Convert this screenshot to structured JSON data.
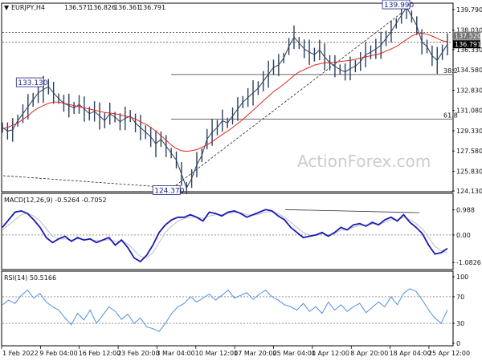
{
  "header": {
    "arrow": "▼",
    "symbol": "EURJPY,H4",
    "open": "136.571",
    "high": "136.826",
    "low": "136.361",
    "close": "136.791"
  },
  "watermark": "ActionForex.com",
  "colors": {
    "price": "#2b3f5c",
    "ma": "#e0251b",
    "macd": "#1a1ab0",
    "signal": "#b8bec9",
    "rsi": "#4f8fe0",
    "tag_dark": "#000000",
    "tag_gray": "#777777"
  },
  "x_axis_labels": [
    "1 Feb 2022",
    "9 Feb 04:00",
    "16 Feb 12:00",
    "23 Feb 20:00",
    "3 Mar 04:00",
    "10 Mar 12:00",
    "17 Mar 20:00",
    "25 Mar 04:00",
    "1 Apr 12:00",
    "8 Apr 20:00",
    "18 Apr 04:00",
    "25 Apr 12:00"
  ],
  "chart_data": [
    {
      "type": "line",
      "panel": "price",
      "y_ticks": [
        "139.790",
        "138.030",
        "137.520",
        "136.791",
        "136.330",
        "134.580",
        "132.830",
        "131.080",
        "129.330",
        "127.580",
        "125.830",
        "124.130"
      ],
      "ylim": [
        124.13,
        140.2
      ],
      "current_tags": [
        "137.520",
        "136.791"
      ],
      "annotations": [
        "133.130",
        "124.370",
        "139.990"
      ],
      "fib_levels": [
        {
          "label": "38.2",
          "value": 134.18
        },
        {
          "label": "61.8",
          "value": 130.32
        }
      ],
      "dotted_levels": [
        137.82,
        136.96
      ],
      "series": [
        {
          "values": [
            129.6,
            129.3,
            129.4,
            130.2,
            130.8,
            131.4,
            132.0,
            132.6,
            132.9,
            133.13,
            132.6,
            132.1,
            131.7,
            131.5,
            131.3,
            131.6,
            131.2,
            130.8,
            131.0,
            130.6,
            130.2,
            130.8,
            130.5,
            130.1,
            130.4,
            130.6,
            130.0,
            129.6,
            129.2,
            128.8,
            128.2,
            128.6,
            128.0,
            127.4,
            126.8,
            125.6,
            124.37,
            125.2,
            126.4,
            127.2,
            128.6,
            129.2,
            129.6,
            130.2,
            130.0,
            130.6,
            131.2,
            131.8,
            132.2,
            132.6,
            133.0,
            133.6,
            134.2,
            134.8,
            135.0,
            135.6,
            136.6,
            137.4,
            136.9,
            136.4,
            136.1,
            135.9,
            136.3,
            135.7,
            135.2,
            134.9,
            134.6,
            134.4,
            134.7,
            134.9,
            135.3,
            135.9,
            136.1,
            136.4,
            136.7,
            137.3,
            137.9,
            138.6,
            139.3,
            139.99,
            139.2,
            138.4,
            137.0,
            136.6,
            135.8,
            135.4,
            136.1,
            136.79
          ]
        },
        {
          "values": [
            129.5,
            129.6,
            129.8,
            130.0,
            130.3,
            130.6,
            131.0,
            131.3,
            131.5,
            131.7,
            131.8,
            131.8,
            131.7,
            131.6,
            131.5,
            131.4,
            131.3,
            131.2,
            131.1,
            131.0,
            130.9,
            130.85,
            130.8,
            130.7,
            130.6,
            130.5,
            130.35,
            130.1,
            129.9,
            129.6,
            129.3,
            128.9,
            128.5,
            128.1,
            127.8,
            127.6,
            127.55,
            127.6,
            127.7,
            127.9,
            128.1,
            128.4,
            128.7,
            129.0,
            129.3,
            129.6,
            129.95,
            130.3,
            130.7,
            131.1,
            131.5,
            131.9,
            132.3,
            132.7,
            133.0,
            133.35,
            133.7,
            134.1,
            134.4,
            134.6,
            134.8,
            135.0,
            135.1,
            135.2,
            135.2,
            135.25,
            135.3,
            135.35,
            135.4,
            135.5,
            135.6,
            135.7,
            135.8,
            135.9,
            136.0,
            136.2,
            136.4,
            136.6,
            136.9,
            137.2,
            137.5,
            137.7,
            137.75,
            137.65,
            137.5,
            137.3,
            137.1,
            137.0
          ]
        }
      ]
    },
    {
      "type": "line",
      "panel": "macd",
      "title": "MACD(12,26,9) -0.5264 -0.7052",
      "y_ticks": [
        "0.988",
        "0.00",
        "-1.0826"
      ],
      "ylim": [
        -1.3,
        1.2
      ],
      "series": [
        {
          "name": "MACD",
          "values": [
            0.3,
            0.6,
            0.9,
            0.95,
            0.85,
            0.6,
            0.3,
            -0.1,
            -0.3,
            -0.15,
            -0.05,
            -0.25,
            -0.1,
            -0.2,
            -0.15,
            -0.3,
            -0.2,
            -0.1,
            -0.4,
            -0.2,
            -0.5,
            -0.9,
            -1.05,
            -0.8,
            -0.4,
            0.1,
            0.4,
            0.6,
            0.7,
            0.7,
            0.8,
            0.7,
            0.55,
            0.9,
            0.85,
            0.75,
            0.9,
            0.95,
            0.85,
            0.7,
            0.8,
            0.9,
            1.0,
            0.95,
            0.75,
            0.6,
            0.3,
            0.1,
            -0.1,
            -0.05,
            0.0,
            0.1,
            -0.05,
            0.1,
            0.3,
            0.2,
            0.4,
            0.45,
            0.35,
            0.5,
            0.4,
            0.6,
            0.7,
            0.55,
            0.8,
            0.5,
            0.3,
            0.05,
            -0.4,
            -0.75,
            -0.7,
            -0.5264
          ]
        },
        {
          "name": "Signal",
          "values": [
            0.2,
            0.4,
            0.6,
            0.8,
            0.85,
            0.75,
            0.55,
            0.25,
            -0.05,
            -0.15,
            -0.15,
            -0.2,
            -0.15,
            -0.18,
            -0.18,
            -0.22,
            -0.22,
            -0.18,
            -0.25,
            -0.25,
            -0.35,
            -0.6,
            -0.85,
            -0.9,
            -0.7,
            -0.3,
            0.1,
            0.35,
            0.55,
            0.65,
            0.7,
            0.7,
            0.65,
            0.75,
            0.8,
            0.8,
            0.85,
            0.9,
            0.88,
            0.8,
            0.78,
            0.82,
            0.9,
            0.93,
            0.85,
            0.7,
            0.5,
            0.3,
            0.1,
            0.0,
            -0.02,
            0.05,
            0.0,
            0.05,
            0.2,
            0.22,
            0.3,
            0.38,
            0.38,
            0.43,
            0.43,
            0.5,
            0.6,
            0.6,
            0.7,
            0.6,
            0.45,
            0.25,
            -0.1,
            -0.45,
            -0.62,
            -0.7052
          ]
        }
      ]
    },
    {
      "type": "line",
      "panel": "rsi",
      "title": "RSI(14) 50.5166",
      "y_ticks": [
        "100",
        "70",
        "30",
        "0"
      ],
      "ylim": [
        0,
        100
      ],
      "levels": [
        70,
        30
      ],
      "series": [
        {
          "name": "RSI",
          "values": [
            58,
            65,
            60,
            72,
            80,
            68,
            75,
            62,
            55,
            50,
            38,
            28,
            45,
            35,
            50,
            30,
            42,
            55,
            48,
            36,
            44,
            30,
            38,
            25,
            22,
            18,
            30,
            45,
            55,
            60,
            70,
            62,
            68,
            74,
            65,
            72,
            80,
            68,
            72,
            76,
            66,
            74,
            80,
            70,
            65,
            58,
            55,
            50,
            60,
            48,
            55,
            45,
            62,
            50,
            58,
            48,
            55,
            60,
            46,
            54,
            62,
            55,
            70,
            58,
            75,
            82,
            78,
            65,
            50,
            38,
            30,
            50.5
          ]
        }
      ]
    }
  ]
}
